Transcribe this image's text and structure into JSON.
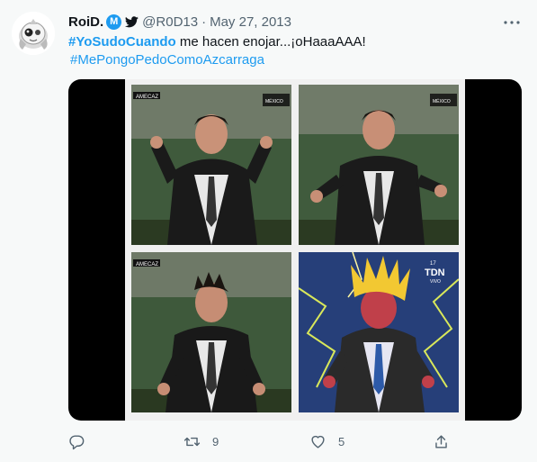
{
  "author": {
    "display_name": "RoiD.",
    "verified_badge": "M",
    "handle": "@R0D13",
    "separator": "·",
    "date": "May 27, 2013"
  },
  "tweet": {
    "hashtag1": "#YoSudoCuando",
    "text": " me hacen enojar...¡oHaaaAAA!",
    "hashtag2": "#MePongoPedoComoAzcarraga"
  },
  "media": {
    "overlays": {
      "score_left": "AME",
      "score_right": "CAZ",
      "channel_tag": "MÉXICO",
      "network": "TDN",
      "network_sub": "VIVO",
      "replay": "17"
    }
  },
  "actions": {
    "reply_icon": "reply-icon",
    "retweet_count": "9",
    "like_count": "5",
    "share_icon": "share-icon"
  },
  "colors": {
    "accent": "#1d9bf0",
    "muted": "#536471",
    "background": "#f7f9f9"
  }
}
